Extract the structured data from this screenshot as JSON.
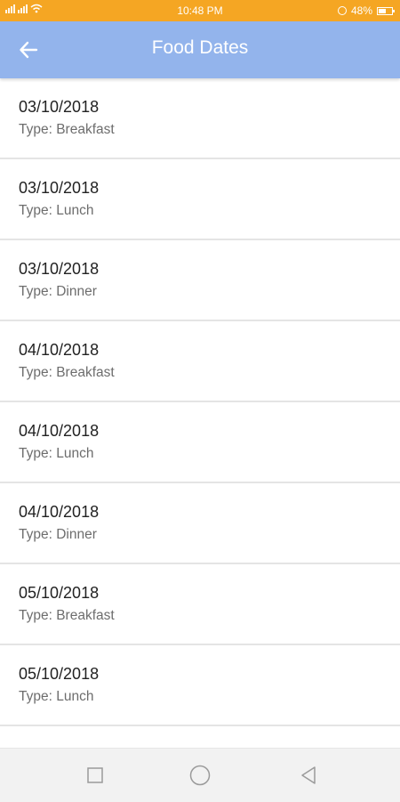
{
  "status_bar": {
    "left": "",
    "time": "10:48 PM",
    "battery": "48%"
  },
  "app_bar": {
    "title": "Food Dates",
    "back_icon": "arrow-left-icon"
  },
  "list": {
    "items": [
      {
        "date": "03/10/2018",
        "type": "Type: Breakfast"
      },
      {
        "date": "03/10/2018",
        "type": "Type: Lunch"
      },
      {
        "date": "03/10/2018",
        "type": "Type: Dinner"
      },
      {
        "date": "04/10/2018",
        "type": "Type: Breakfast"
      },
      {
        "date": "04/10/2018",
        "type": "Type: Lunch"
      },
      {
        "date": "04/10/2018",
        "type": "Type: Dinner"
      },
      {
        "date": "05/10/2018",
        "type": "Type: Breakfast"
      },
      {
        "date": "05/10/2018",
        "type": "Type: Lunch"
      }
    ]
  },
  "nav_bar": {
    "recent_icon": "square-icon",
    "home_icon": "circle-icon",
    "back_icon": "triangle-back-icon"
  },
  "colors": {
    "status_bar": "#f5a623",
    "app_bar": "#93b4ec",
    "divider": "#e4e4e4"
  }
}
